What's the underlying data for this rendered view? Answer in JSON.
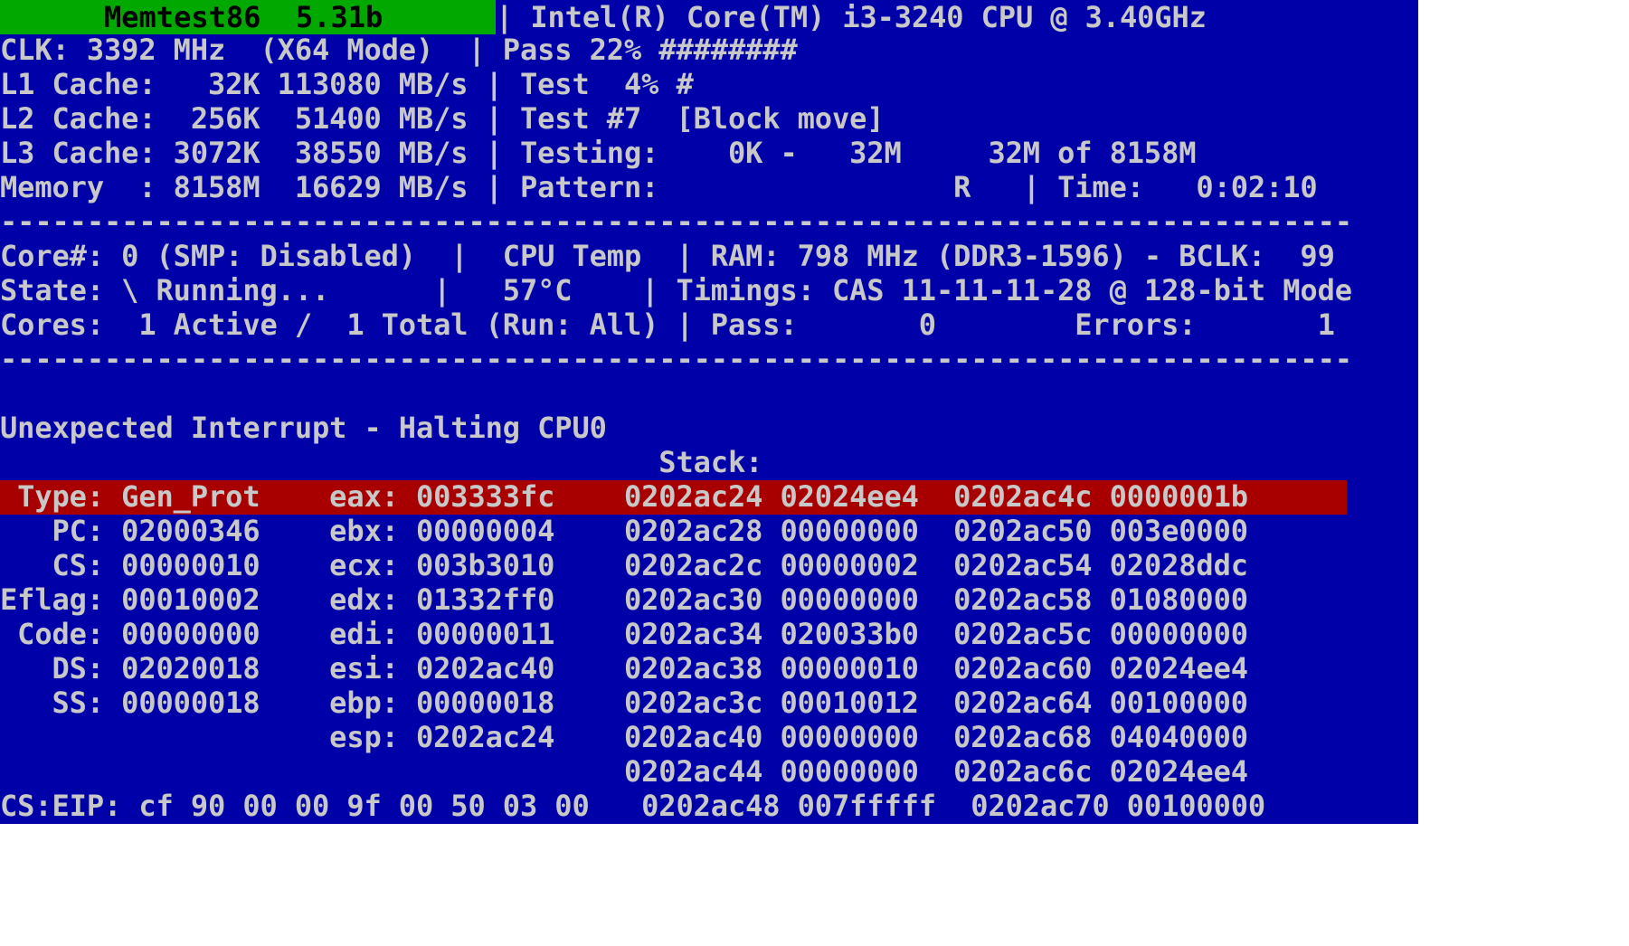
{
  "header": {
    "title": "Memtest86  5.31b",
    "cpu": "| Intel(R) Core(TM) i3-3240 CPU @ 3.40GHz",
    "clk": "CLK: 3392 MHz  (X64 Mode)  | Pass 22% ########",
    "l1": "L1 Cache:   32K 113080 MB/s | Test  4% #",
    "l2": "L2 Cache:  256K  51400 MB/s | Test #7  [Block move]",
    "l3": "L3 Cache: 3072K  38550 MB/s | Testing:    0K -   32M     32M of 8158M",
    "memory": "Memory  : 8158M  16629 MB/s | Pattern:                 R   | Time:   0:02:10"
  },
  "separator": "------------------------------------------------------------------------------",
  "status": {
    "core": "Core#: 0 (SMP: Disabled)  |  CPU Temp  | RAM: 798 MHz (DDR3-1596) - BCLK:  99",
    "state": "State: \\ Running...      |   57°C    | Timings: CAS 11-11-11-28 @ 128-bit Mode",
    "cores": "Cores:  1 Active /  1 Total (Run: All) | Pass:       0        Errors:       1"
  },
  "error": {
    "message": "Unexpected Interrupt - Halting CPU0",
    "stack_label": "                                      Stack:",
    "rows": [
      " Type: Gen_Prot    eax: 003333fc    0202ac24 02024ee4  0202ac4c 0000001b",
      "   PC: 02000346    ebx: 00000004    0202ac28 00000000  0202ac50 003e0000",
      "   CS: 00000010    ecx: 003b3010    0202ac2c 00000002  0202ac54 02028ddc",
      "Eflag: 00010002    edx: 01332ff0    0202ac30 00000000  0202ac58 01080000",
      " Code: 00000000    edi: 00000011    0202ac34 020033b0  0202ac5c 00000000",
      "   DS: 02020018    esi: 0202ac40    0202ac38 00000010  0202ac60 02024ee4",
      "   SS: 00000018    ebp: 00000018    0202ac3c 00010012  0202ac64 00100000",
      "                   esp: 0202ac24    0202ac40 00000000  0202ac68 04040000",
      "                                    0202ac44 00000000  0202ac6c 02024ee4"
    ],
    "cs_eip": "CS:EIP: cf 90 00 00 9f 00 50 03 00   0202ac48 007fffff  0202ac70 00100000"
  },
  "colors": {
    "background": "#0000a8",
    "text": "#c8c8c8",
    "title_bar": "#00a800",
    "error_bar": "#a80000"
  }
}
